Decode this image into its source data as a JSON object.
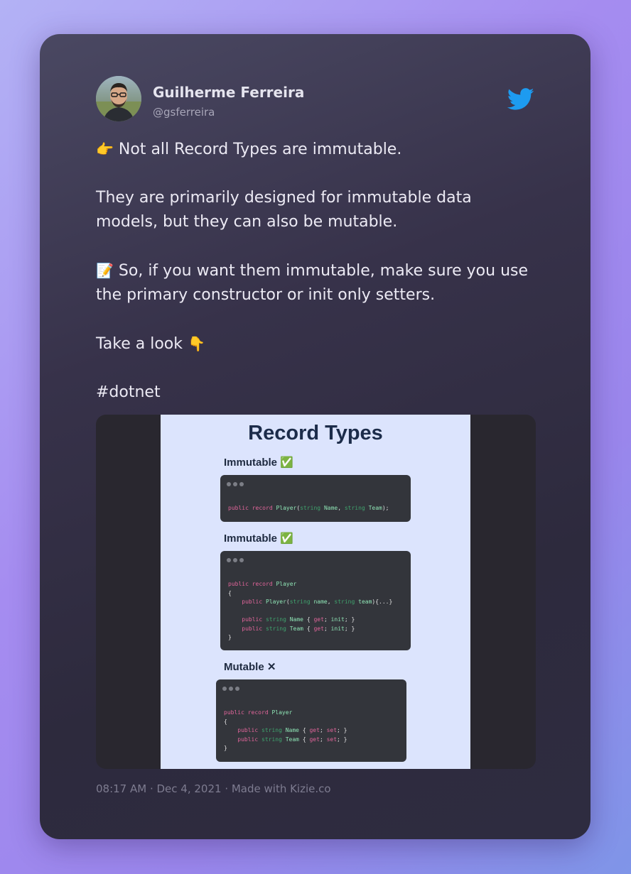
{
  "author": {
    "name": "Guilherme Ferreira",
    "handle": "@gsferreira"
  },
  "icons": {
    "brand": "twitter-bird-icon",
    "point_right": "👉",
    "memo": "📝",
    "point_down": "👇"
  },
  "tweet": {
    "line1": "Not all Record Types are immutable.",
    "line2": "They are primarily designed for immutable data models, but they can also be mutable.",
    "line3": "So, if you want them immutable, make sure you use the primary constructor or init only setters.",
    "line4": "Take a look",
    "line5": "#dotnet"
  },
  "slide": {
    "title": "Record Types",
    "sections": [
      {
        "label": "Immutable ✅",
        "code": [
          "public record Player(string Name, string Team);"
        ]
      },
      {
        "label": "Immutable ✅",
        "code": [
          "public record Player",
          "{",
          "    public Player(string name, string team){...}",
          "",
          "    public string Name { get; init; }",
          "    public string Team { get; init; }",
          "}"
        ]
      },
      {
        "label": "Mutable ✕",
        "code": [
          "public record Player",
          "{",
          "    public string Name { get; set; }",
          "    public string Team { get; set; }",
          "}"
        ]
      }
    ]
  },
  "footer": {
    "text": "08:17 AM · Dec 4, 2021 · Made with Kizie.co"
  },
  "colors": {
    "twitter_blue": "#1d9bf0",
    "keyword": "#e0659a",
    "type": "#3fa36d",
    "identifier": "#8ee3b4"
  }
}
